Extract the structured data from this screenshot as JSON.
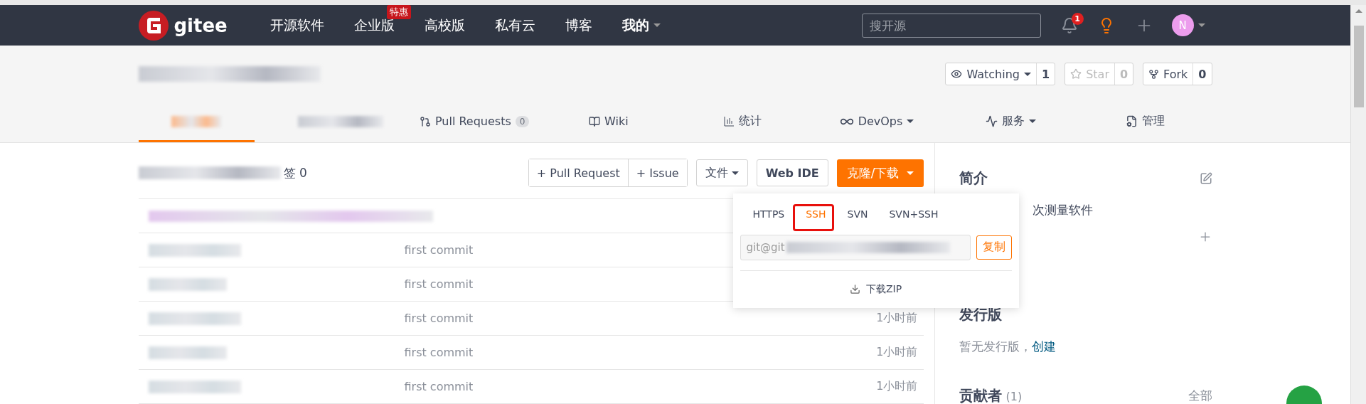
{
  "navbar": {
    "logo": "gitee",
    "items": [
      {
        "label": "开源软件"
      },
      {
        "label": "企业版",
        "badge": "特惠"
      },
      {
        "label": "高校版"
      },
      {
        "label": "私有云"
      },
      {
        "label": "博客"
      },
      {
        "label": "我的",
        "dropdown": true
      }
    ],
    "search": {
      "placeholder": "搜开源"
    },
    "notifications": "1",
    "avatar": "N"
  },
  "repo_header": {
    "actions": [
      {
        "label": "Watching",
        "count": "1",
        "dropdown": true,
        "disabled": false
      },
      {
        "label": "Star",
        "count": "0",
        "dropdown": false,
        "disabled": true
      },
      {
        "label": "Fork",
        "count": "0",
        "dropdown": false,
        "disabled": false
      }
    ],
    "tabs": [
      {
        "kind": "blurred",
        "selected": true
      },
      {
        "kind": "blurred",
        "selected": false
      },
      {
        "kind": "text",
        "label": "Pull Requests",
        "count": "0",
        "selected": false
      },
      {
        "kind": "text",
        "label": "Wiki",
        "selected": false
      },
      {
        "kind": "text",
        "label": "统计",
        "selected": false
      },
      {
        "kind": "text",
        "label": "DevOps",
        "dropdown": true,
        "selected": false
      },
      {
        "kind": "text",
        "label": "服务",
        "dropdown": true,
        "selected": false
      },
      {
        "kind": "text",
        "label": "管理",
        "selected": false
      }
    ]
  },
  "toolbar": {
    "summary": "签 0",
    "buttons": [
      "+ Pull Request",
      "+ Issue"
    ],
    "file_menu": "文件",
    "web_ide": "Web IDE",
    "clone": "克隆/下载"
  },
  "clone_popup": {
    "tabs": [
      {
        "label": "HTTPS",
        "selected": false
      },
      {
        "label": "SSH",
        "selected": true
      },
      {
        "label": "SVN",
        "selected": false
      },
      {
        "label": "SVN+SSH",
        "selected": false
      }
    ],
    "url": "git@git",
    "copy": "复制",
    "download": "下载ZIP"
  },
  "files": [
    {
      "message": "first commit"
    },
    {
      "message": "first commit"
    },
    {
      "message": "first commit",
      "time": "1小时前"
    },
    {
      "message": "first commit",
      "time": "1小时前"
    },
    {
      "message": "first commit",
      "time": "1小时前"
    }
  ],
  "sidebar": {
    "intro_title": "简介",
    "description": "次测量软件",
    "releases_title": "发行版",
    "releases_empty": "暂无发行版，",
    "create_link": "创建",
    "contributors_title": "贡献者",
    "contributors_count": "(1)",
    "all_link": "全部"
  }
}
